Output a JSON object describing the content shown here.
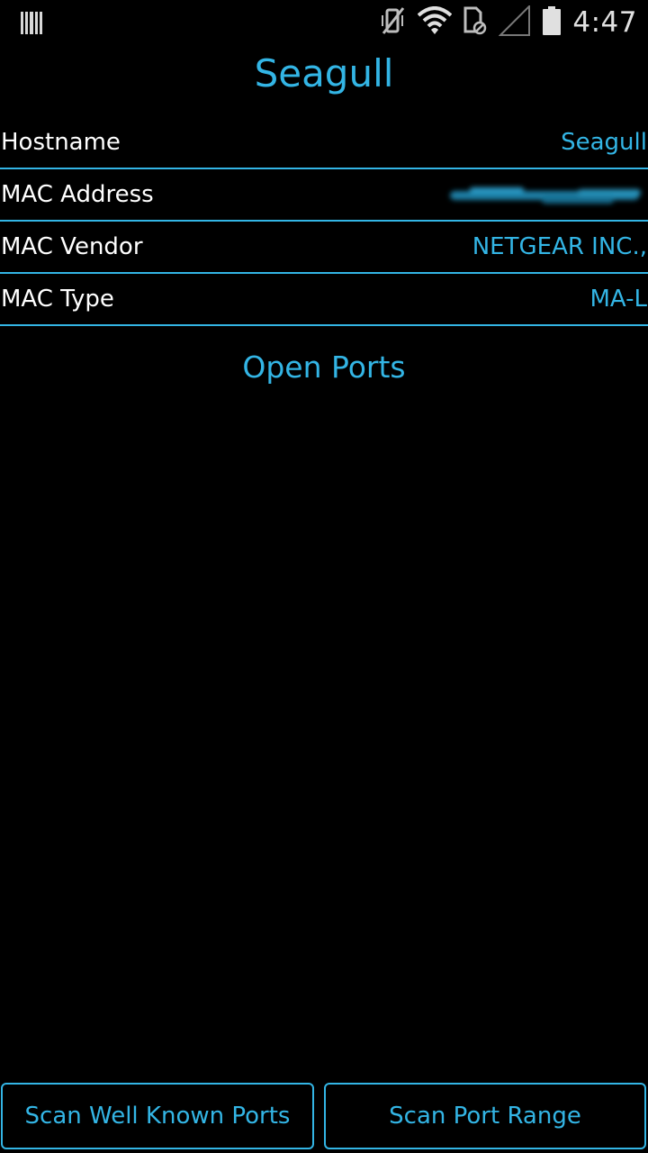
{
  "status_bar": {
    "time": "4:47",
    "icons": [
      "barcode-icon",
      "vibrate-off-icon",
      "wifi-icon",
      "sim-blocked-icon",
      "signal-icon",
      "battery-icon"
    ]
  },
  "title": "Seagull",
  "info_rows": [
    {
      "label": "Hostname",
      "value": "Seagull"
    },
    {
      "label": "MAC Address",
      "value": ""
    },
    {
      "label": "MAC Vendor",
      "value": "NETGEAR INC.,"
    },
    {
      "label": "MAC Type",
      "value": "MA-L"
    }
  ],
  "section_title": "Open Ports",
  "buttons": {
    "scan_well_known": "Scan Well Known Ports",
    "scan_range": "Scan Port Range"
  },
  "colors": {
    "accent": "#33b5e5",
    "background": "#000000",
    "text": "#ffffff"
  }
}
